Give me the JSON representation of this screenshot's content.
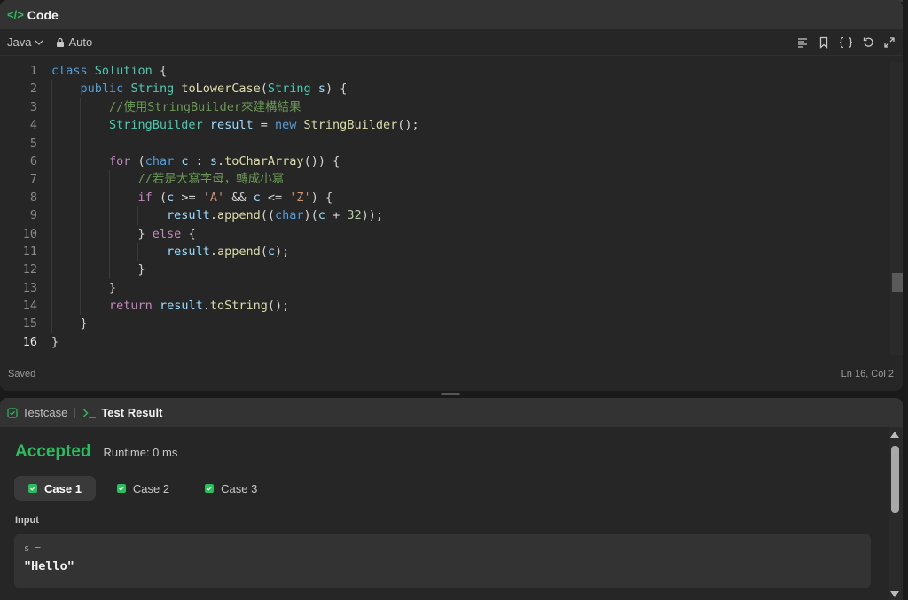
{
  "code_panel": {
    "title": "Code",
    "language": "Java",
    "mode": "Auto",
    "status_left": "Saved",
    "status_right": "Ln 16, Col 2",
    "toolbar_icons": [
      "format-icon",
      "bookmark-icon",
      "braces-icon",
      "reset-icon",
      "expand-icon"
    ]
  },
  "code_lines": [
    "class Solution {",
    "    public String toLowerCase(String s) {",
    "        //使用StringBuilder來建構結果",
    "        StringBuilder result = new StringBuilder();",
    "",
    "        for (char c : s.toCharArray()) {",
    "            //若是大寫字母，轉成小寫",
    "            if (c >= 'A' && c <= 'Z') {",
    "                result.append((char)(c + 32));",
    "            } else {",
    "                result.append(c);",
    "            }",
    "        }",
    "        return result.toString();",
    "    }",
    "}"
  ],
  "line_numbers": [
    "1",
    "2",
    "3",
    "4",
    "5",
    "6",
    "7",
    "8",
    "9",
    "10",
    "11",
    "12",
    "13",
    "14",
    "15",
    "16"
  ],
  "result_panel": {
    "tab_testcase": "Testcase",
    "tab_result": "Test Result",
    "verdict": "Accepted",
    "runtime": "Runtime: 0 ms",
    "cases": [
      "Case 1",
      "Case 2",
      "Case 3"
    ],
    "active_case": "Case 1",
    "input_label": "Input",
    "input_var": "s =",
    "input_value": "\"Hello\""
  },
  "colors": {
    "accent_green": "#2cbb5d",
    "keyword": "#569cd6",
    "control": "#c586c0",
    "type": "#4ec9b0",
    "function": "#dcdcaa",
    "variable": "#9cdcfe",
    "comment": "#6a9955",
    "string": "#ce9178",
    "number": "#b5cea8"
  }
}
